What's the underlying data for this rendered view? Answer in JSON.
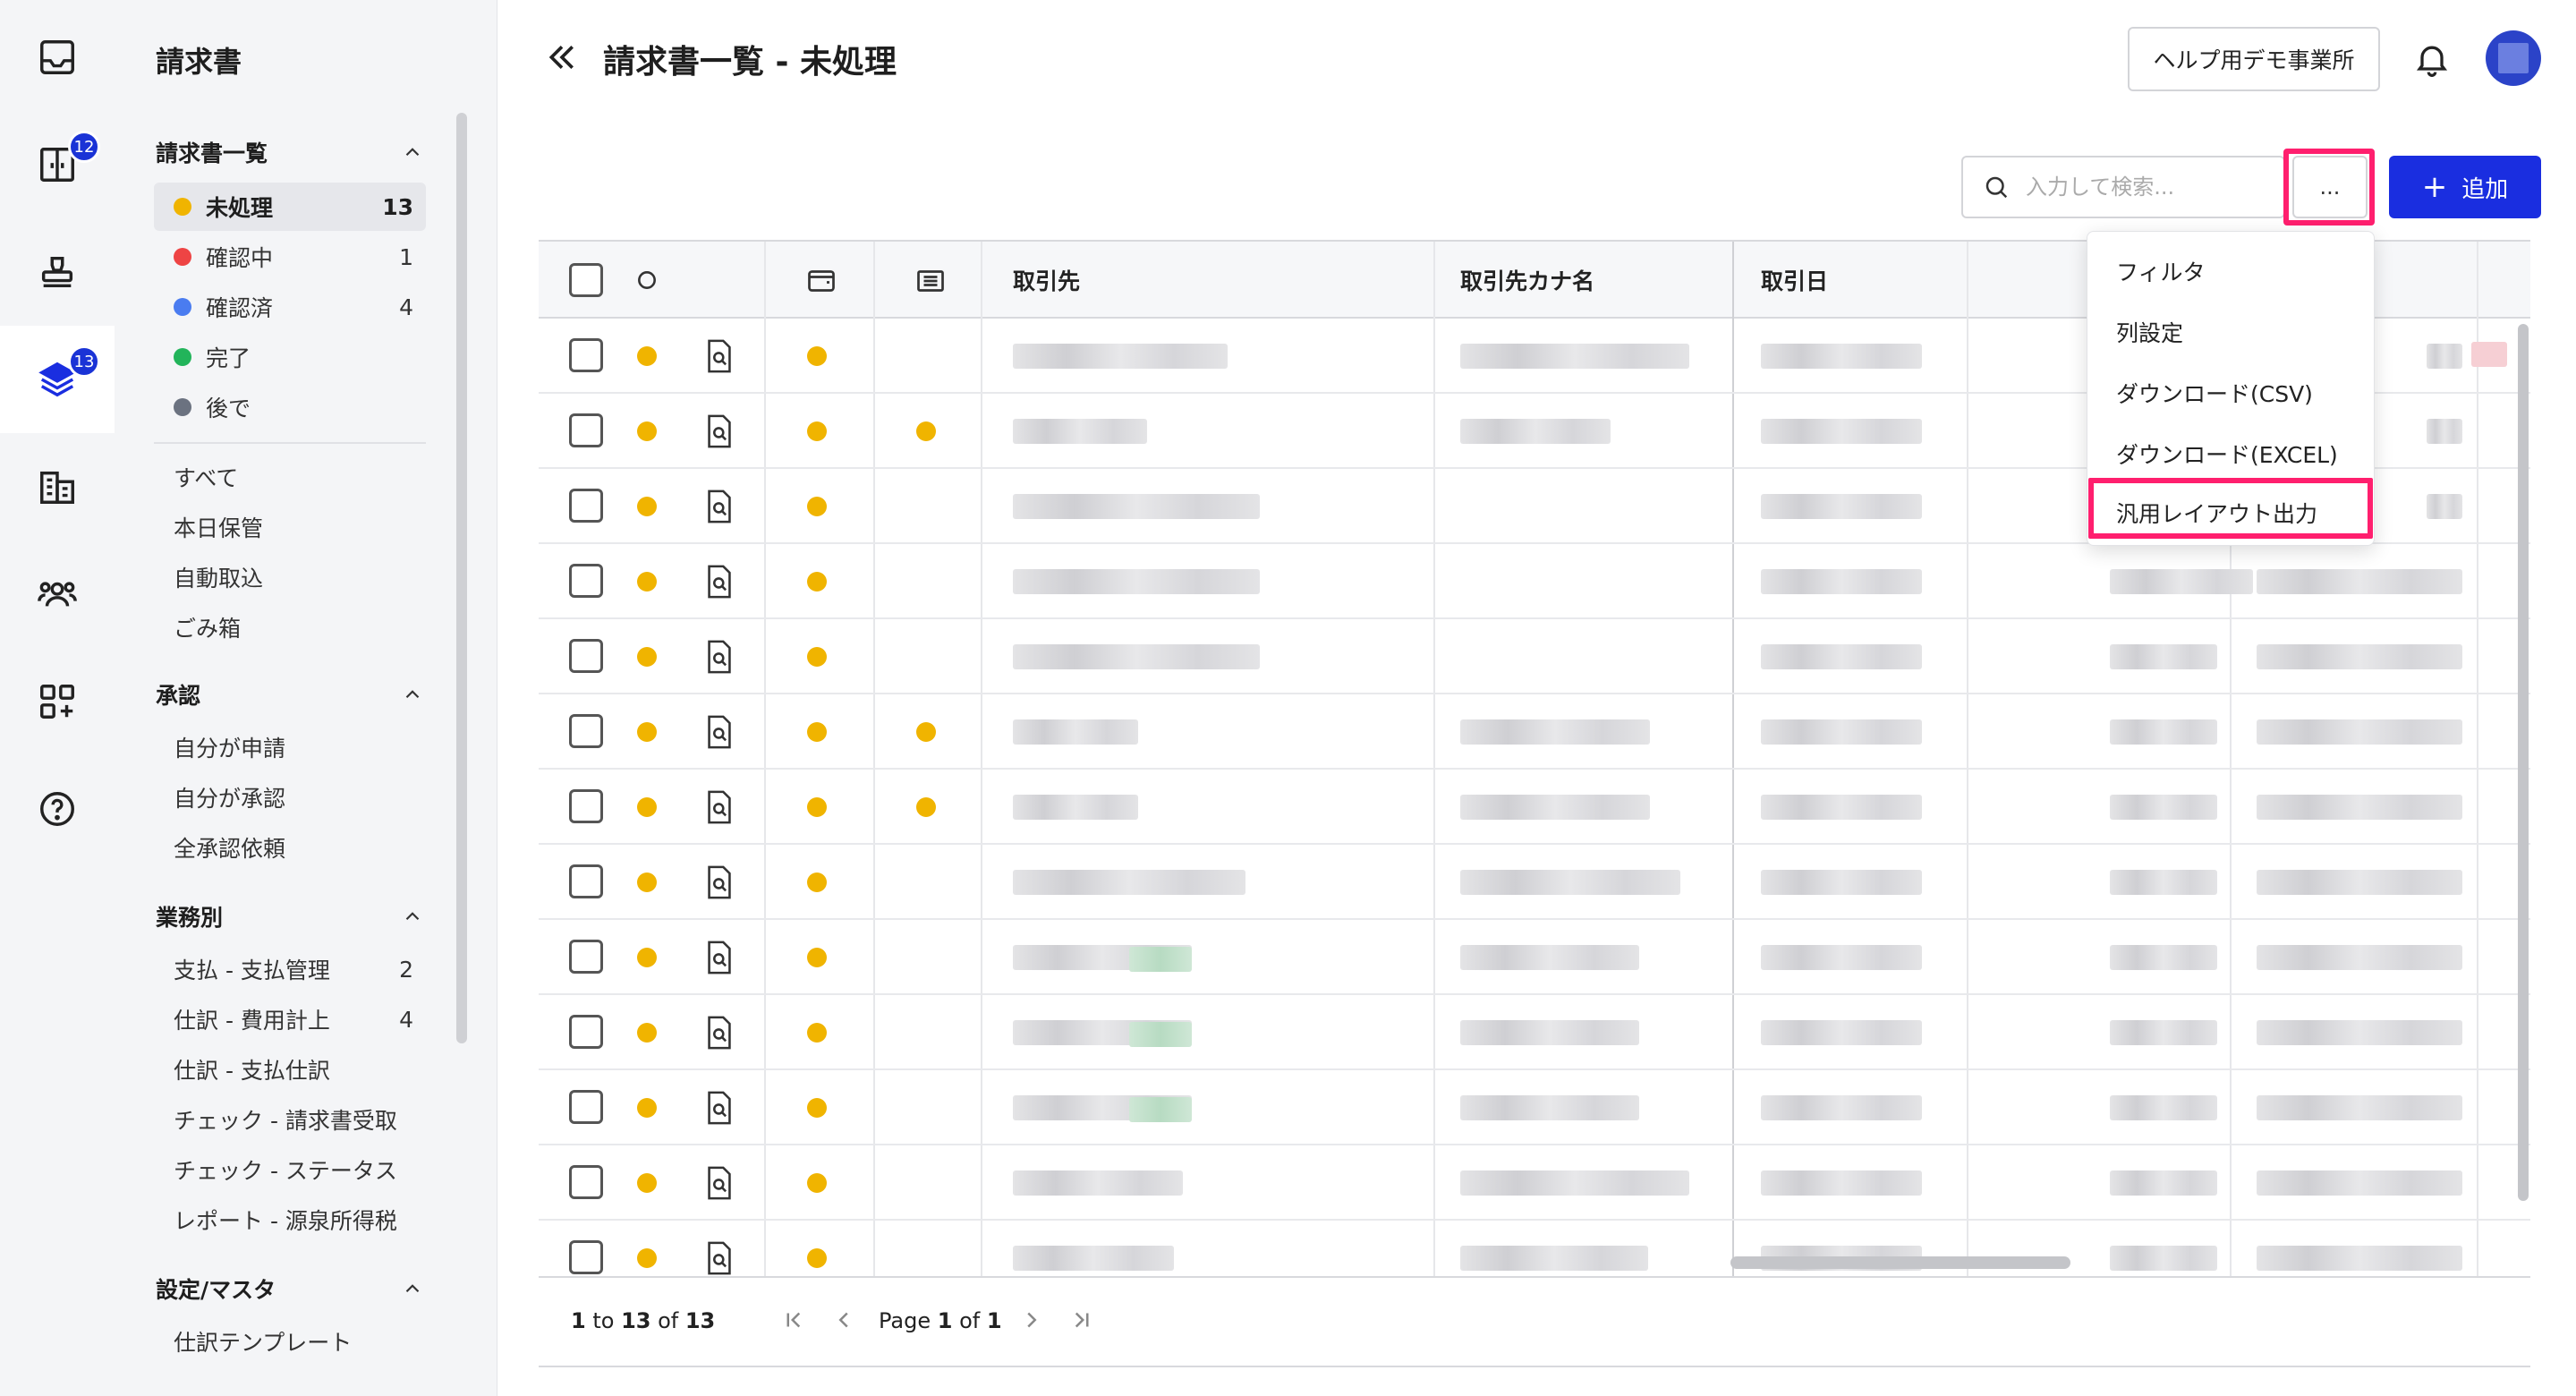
{
  "rail": {
    "items": [
      {
        "icon": "inbox-icon"
      },
      {
        "icon": "split-door-icon",
        "badge": "12"
      },
      {
        "icon": "stamp-icon"
      },
      {
        "icon": "stack-layers-icon",
        "badge": "13"
      },
      {
        "icon": "buildings-icon"
      },
      {
        "icon": "people-icon"
      },
      {
        "icon": "apps-add-icon"
      },
      {
        "icon": "help-icon"
      }
    ]
  },
  "sidebar": {
    "title": "請求書",
    "sections": [
      {
        "label": "請求書一覧",
        "items": [
          {
            "label": "未処理",
            "count": "13",
            "dot": "#f0b400"
          },
          {
            "label": "確認中",
            "count": "1",
            "dot": "#ee4444"
          },
          {
            "label": "確認済",
            "count": "4",
            "dot": "#4a7cf0"
          },
          {
            "label": "完了",
            "count": "",
            "dot": "#22b45a"
          },
          {
            "label": "後で",
            "count": "",
            "dot": "#6b7280"
          }
        ],
        "extra": [
          {
            "label": "すべて"
          },
          {
            "label": "本日保管"
          },
          {
            "label": "自動取込"
          },
          {
            "label": "ごみ箱"
          }
        ]
      },
      {
        "label": "承認",
        "items": [
          {
            "label": "自分が申請"
          },
          {
            "label": "自分が承認"
          },
          {
            "label": "全承認依頼"
          }
        ]
      },
      {
        "label": "業務別",
        "items": [
          {
            "label": "支払 - 支払管理",
            "count": "2"
          },
          {
            "label": "仕訳 - 費用計上",
            "count": "4"
          },
          {
            "label": "仕訳 - 支払仕訳",
            "count": ""
          },
          {
            "label": "チェック - 請求書受取",
            "count": ""
          },
          {
            "label": "チェック - ステータス",
            "count": ""
          },
          {
            "label": "レポート - 源泉所得税",
            "count": ""
          }
        ]
      },
      {
        "label": "設定/マスタ",
        "items": [
          {
            "label": "仕訳テンプレート"
          }
        ]
      }
    ]
  },
  "header": {
    "title": "請求書一覧 - 未処理",
    "office_button": "ヘルプ用デモ事業所"
  },
  "toolbar": {
    "search_placeholder": "入力して検索...",
    "more_label": "...",
    "add_label": "追加"
  },
  "table": {
    "columns": [
      "取引先",
      "取引先カナ名",
      "取引日"
    ],
    "row_count": 13,
    "rows_with_second_dot": [
      1,
      5,
      6
    ]
  },
  "dropdown": {
    "items": [
      "フィルタ",
      "列設定",
      "ダウンロード(CSV)",
      "ダウンロード(EXCEL)",
      "汎用レイアウト出力"
    ],
    "highlighted_index": 4
  },
  "footer": {
    "range_from": "1",
    "range_to": "13",
    "total": "13",
    "page": "1",
    "pages": "1"
  },
  "colors": {
    "accent": "#1a2ee0",
    "highlight": "#ff1f6e",
    "pending_dot": "#f0b400"
  }
}
